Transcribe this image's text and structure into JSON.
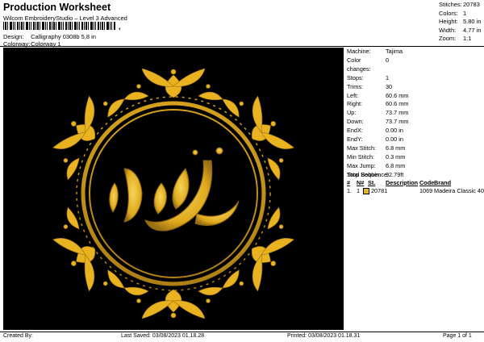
{
  "header": {
    "title": "Production Worksheet",
    "subtitle": "Wilcom EmbroideryStudio – Level 3 Advanced",
    "barcode_tail": ","
  },
  "meta": [
    {
      "label": "Design:",
      "value": "Calligraphy 0308b 5,8 in"
    },
    {
      "label": "Colorway:",
      "value": "Colorway 1"
    }
  ],
  "top_right": [
    {
      "label": "Stitches:",
      "value": "20783"
    },
    {
      "label": "Colors:",
      "value": "1"
    },
    {
      "label": "Height:",
      "value": "5.80 in"
    },
    {
      "label": "Width:",
      "value": "4.77 in"
    },
    {
      "label": "Zoom:",
      "value": "1:1"
    }
  ],
  "machine_info": [
    {
      "label": "Machine:",
      "value": "Tajima"
    },
    {
      "label": "Color changes:",
      "value": "0"
    },
    {
      "label": "Stops:",
      "value": "1"
    },
    {
      "label": "Trims:",
      "value": "30"
    },
    {
      "label": "Left:",
      "value": "60.6 mm"
    },
    {
      "label": "Right:",
      "value": "60.6 mm"
    },
    {
      "label": "Up:",
      "value": "73.7 mm"
    },
    {
      "label": "Down:",
      "value": "73.7 mm"
    },
    {
      "label": "EndX:",
      "value": "0.00 in"
    },
    {
      "label": "EndY:",
      "value": "0.00 in"
    },
    {
      "label": "Max Stitch:",
      "value": "6.8 mm"
    },
    {
      "label": "Min Stitch:",
      "value": "0.3 mm"
    },
    {
      "label": "Max Jump:",
      "value": "6.8 mm"
    },
    {
      "label": "Total Bobbin:",
      "value": "92.79ft"
    }
  ],
  "stop_sequence": {
    "title": "Stop Sequence:",
    "headers": [
      "#",
      "N#",
      "St.",
      "Description",
      "Code",
      "Brand"
    ],
    "rows": [
      {
        "num": "1.",
        "n": "1",
        "color": "#E8B220",
        "stitches": "20781",
        "description": "",
        "code": "1069",
        "brand": "Madeira Classic 40"
      }
    ]
  },
  "footer": {
    "created_by": "Created By:",
    "last_saved": "Last Saved: 03/08/2023 01.18.28",
    "printed": "Printed: 03/08/2023 01.18.31",
    "page": "Page 1 of 1"
  },
  "colors": {
    "thread": "#E8B220",
    "thread_dark": "#8A6410",
    "background": "#000000"
  }
}
